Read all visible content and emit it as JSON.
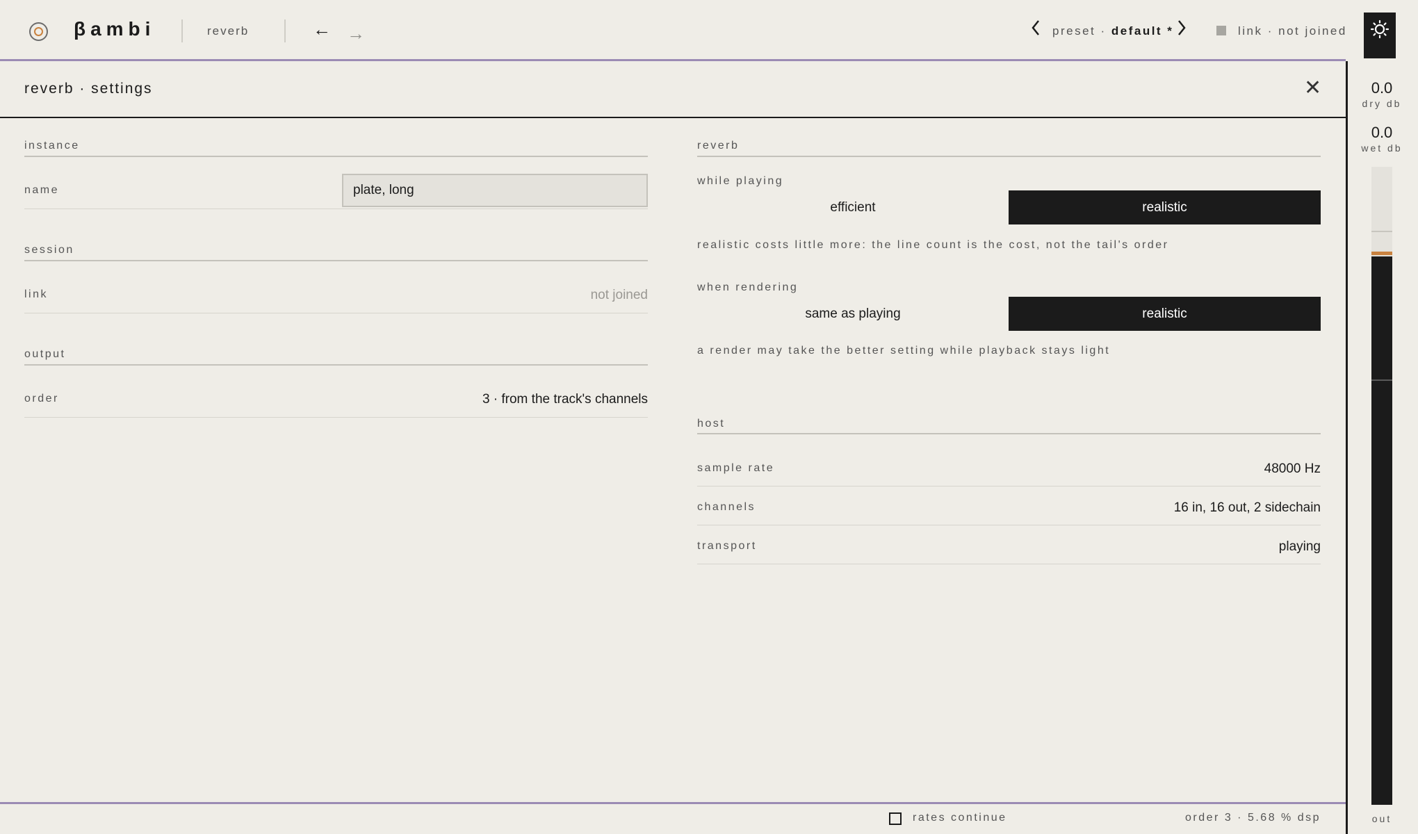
{
  "header": {
    "brand": "βambi",
    "plugin": "reverb",
    "back_arrow": "←",
    "forward_arrow": "→",
    "preset_label": "preset · ",
    "preset_name": "default *",
    "prev_preset": "‹",
    "next_preset": "›",
    "link_status": "link · not joined"
  },
  "panel": {
    "title": "reverb · settings",
    "close": "✕"
  },
  "left": {
    "instance": {
      "heading": "instance",
      "name_label": "name",
      "name_value": "plate, long"
    },
    "session": {
      "heading": "session",
      "link_label": "link",
      "link_value": "not joined"
    },
    "output": {
      "heading": "output",
      "order_label": "order",
      "order_value": "3 · from the track's channels"
    }
  },
  "right": {
    "reverb": {
      "heading": "reverb",
      "while_playing": {
        "label": "while playing",
        "options": [
          "efficient",
          "realistic"
        ],
        "selected": "realistic",
        "hint": "realistic costs little more: the line count is the cost, not the tail's order"
      },
      "when_rendering": {
        "label": "when rendering",
        "options": [
          "same as playing",
          "realistic"
        ],
        "selected": "realistic",
        "hint": "a render may take the better setting while playback stays light"
      }
    },
    "host": {
      "heading": "host",
      "rows": [
        {
          "label": "sample rate",
          "value": "48000 Hz"
        },
        {
          "label": "channels",
          "value": "16 in, 16 out, 2 sidechain"
        },
        {
          "label": "transport",
          "value": "playing"
        }
      ]
    }
  },
  "meters": {
    "dry_value": "0.0",
    "dry_label": "dry db",
    "wet_value": "0.0",
    "wet_label": "wet db",
    "out_label": "out",
    "out_level": 0.86
  },
  "footer": {
    "rates_label": "rates continue",
    "rates_checked": false,
    "status": "order 3 · 5.68 % dsp"
  },
  "colors": {
    "background": "#efede7",
    "ink": "#1b1b1b",
    "accent_rule": "#9b8bb4",
    "peak": "#c9823f"
  }
}
